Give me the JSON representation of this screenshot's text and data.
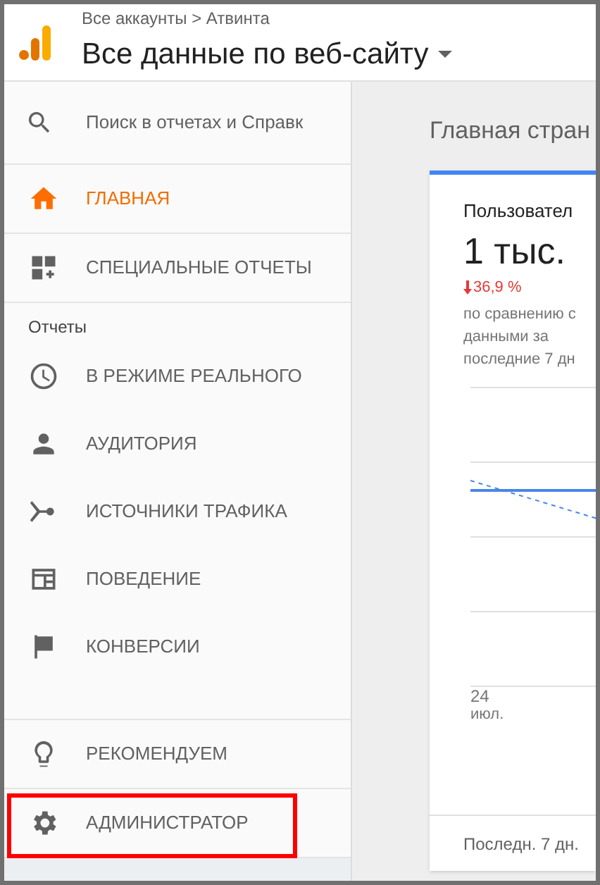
{
  "header": {
    "breadcrumb": "Все аккаунты > Атвинта",
    "view_title": "Все данные по веб-сайту"
  },
  "sidebar": {
    "search": {
      "placeholder": "Поиск в отчетах и Справк"
    },
    "top_items": [
      {
        "kind": "home",
        "label": "ГЛАВНАЯ",
        "selected": true
      },
      {
        "kind": "custom",
        "label": "СПЕЦИАЛЬНЫЕ ОТЧЕТЫ",
        "selected": false
      }
    ],
    "section_label": "Отчеты",
    "report_items": [
      {
        "kind": "clock",
        "label": "В РЕЖИМЕ РЕАЛЬНОГО"
      },
      {
        "kind": "person",
        "label": "АУДИТОРИЯ"
      },
      {
        "kind": "fork",
        "label": "ИСТОЧНИКИ ТРАФИКА"
      },
      {
        "kind": "layout",
        "label": "ПОВЕДЕНИЕ"
      },
      {
        "kind": "flag",
        "label": "КОНВЕРСИИ"
      }
    ],
    "bottom_items": [
      {
        "kind": "bulb",
        "label": "РЕКОМЕНДУЕМ",
        "highlighted": false
      },
      {
        "kind": "gear",
        "label": "АДМИНИСТРАТОР",
        "highlighted": true
      }
    ]
  },
  "main": {
    "page_title": "Главная стран",
    "card": {
      "metric": "Пользовател",
      "value": "1 тыс.",
      "change": "36,9 %",
      "compare": [
        "по сравнению с",
        "данными за",
        "последние 7 дн"
      ],
      "x_label_day": "24",
      "x_label_month": "июл.",
      "footer": "Последн. 7 дн."
    }
  }
}
